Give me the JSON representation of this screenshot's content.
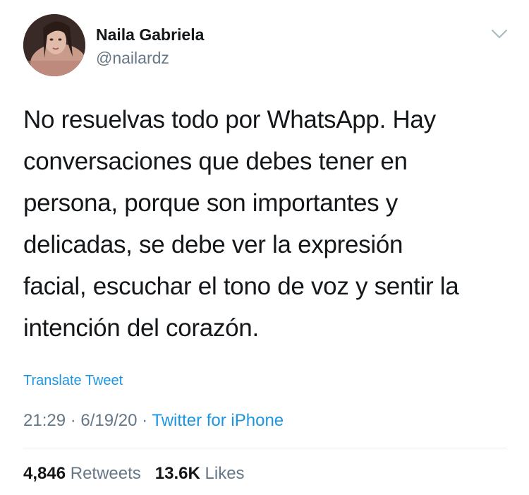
{
  "tweet": {
    "author": {
      "name": "Naila Gabriela",
      "handle": "@nailardz"
    },
    "text_lines": [
      "No resuelvas todo por WhatsApp. Hay",
      "conversaciones que debes tener en",
      "persona, porque son importantes y",
      "delicadas, se debe ver la expresión",
      "facial, escuchar el tono de voz y sentir la",
      "intención del corazón."
    ],
    "translate_label": "Translate Tweet",
    "time": "21:29",
    "date": "6/19/20",
    "separator": "·",
    "source": "Twitter for iPhone",
    "stats": {
      "retweets_count": "4,846",
      "retweets_label": "Retweets",
      "likes_count": "13.6K",
      "likes_label": "Likes"
    }
  },
  "icons": {
    "menu": "chevron-down-icon"
  },
  "colors": {
    "text": "#14171a",
    "secondary": "#657786",
    "link": "#1b95e0",
    "divider": "#e6ecf0"
  }
}
